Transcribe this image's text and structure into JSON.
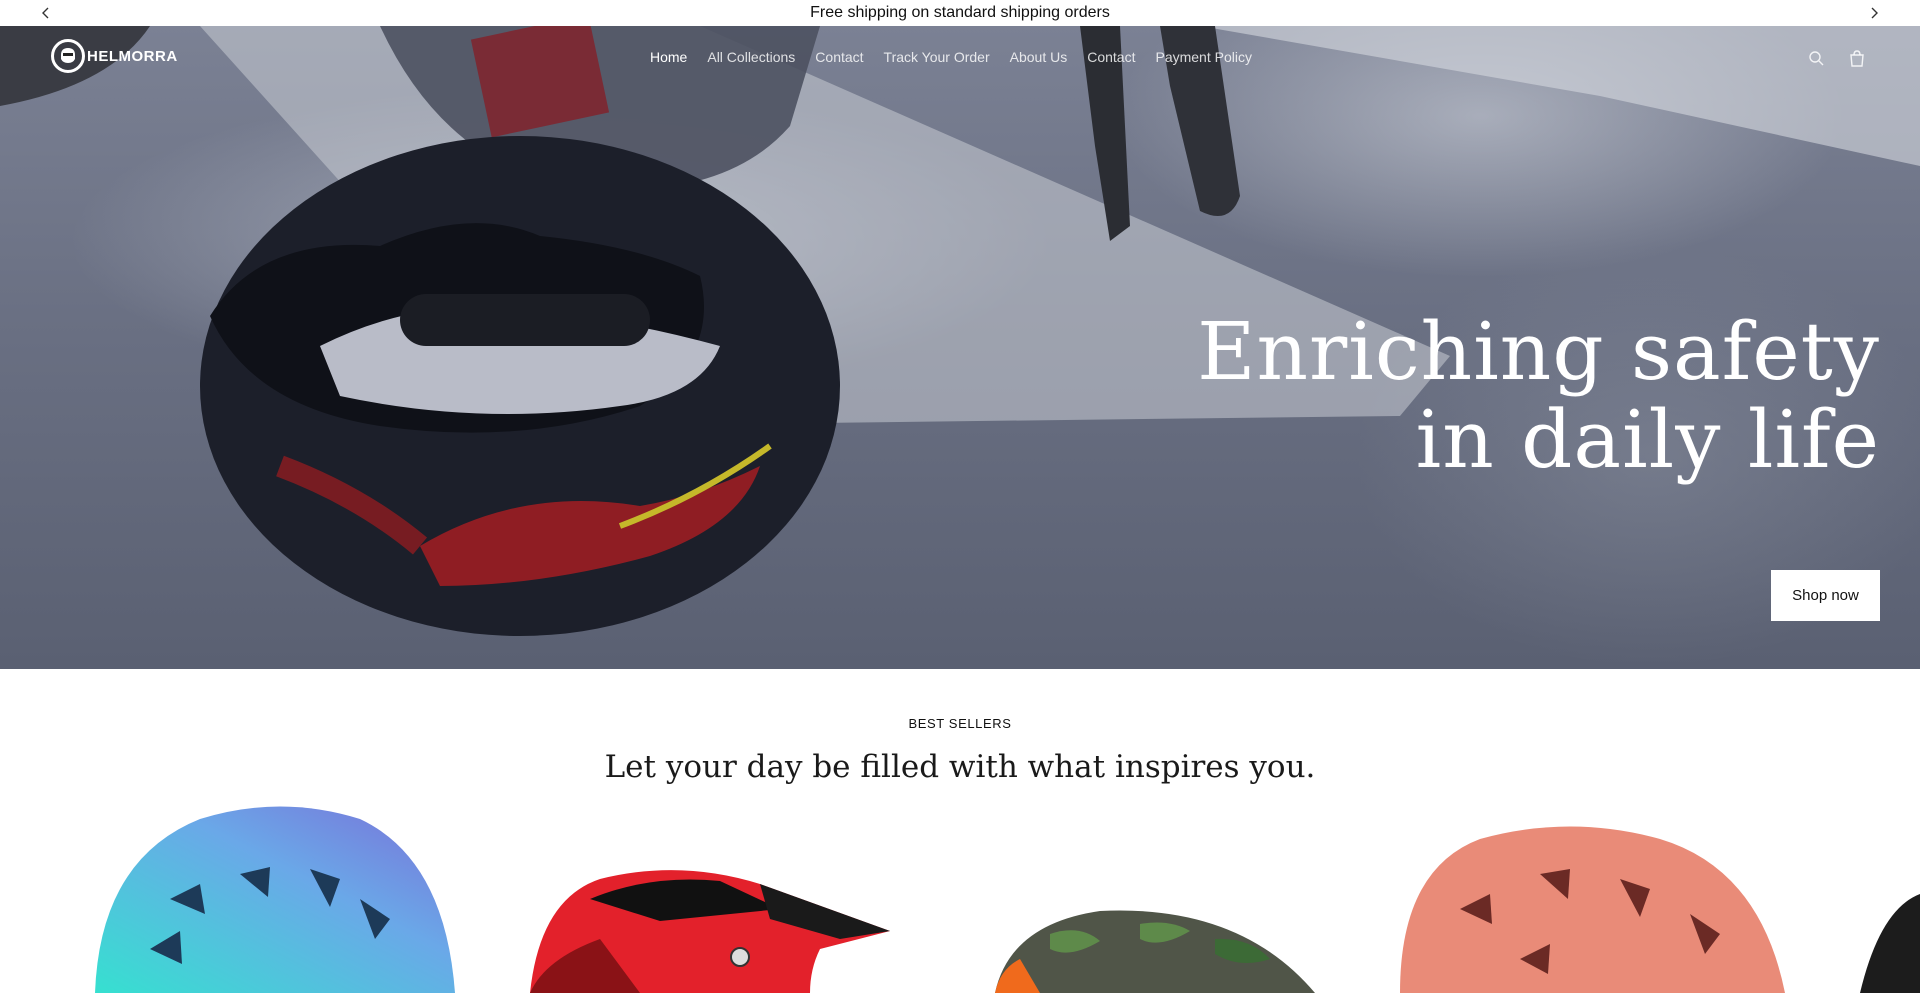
{
  "announcement": {
    "text": "Free shipping on standard shipping orders",
    "prev_icon": "chevron-left-icon",
    "next_icon": "chevron-right-icon"
  },
  "header": {
    "logo_text": "HELMORRA",
    "nav": [
      {
        "label": "Home",
        "active": true
      },
      {
        "label": "All Collections"
      },
      {
        "label": "Contact"
      },
      {
        "label": "Track Your Order"
      },
      {
        "label": "About Us"
      },
      {
        "label": "Contact"
      },
      {
        "label": "Payment Policy"
      }
    ],
    "icons": [
      "search-icon",
      "cart-icon"
    ]
  },
  "hero": {
    "headline_line1": "Enriching safety",
    "headline_line2": "in daily life",
    "button_label": "Shop now"
  },
  "best_sellers": {
    "eyebrow": "BEST SELLERS",
    "subtitle": "Let your day be filled with what inspires you.",
    "products": [
      {
        "name": "turquoise-purple-helmet",
        "color": "#5fd0e0"
      },
      {
        "name": "red-black-moto-helmet",
        "color": "#e0222a"
      },
      {
        "name": "camo-orange-helmet",
        "color": "#5a5f55"
      },
      {
        "name": "coral-helmet",
        "color": "#e58a78"
      }
    ]
  },
  "colors": {
    "hero_text": "#ffffff",
    "button_bg": "#ffffff"
  }
}
